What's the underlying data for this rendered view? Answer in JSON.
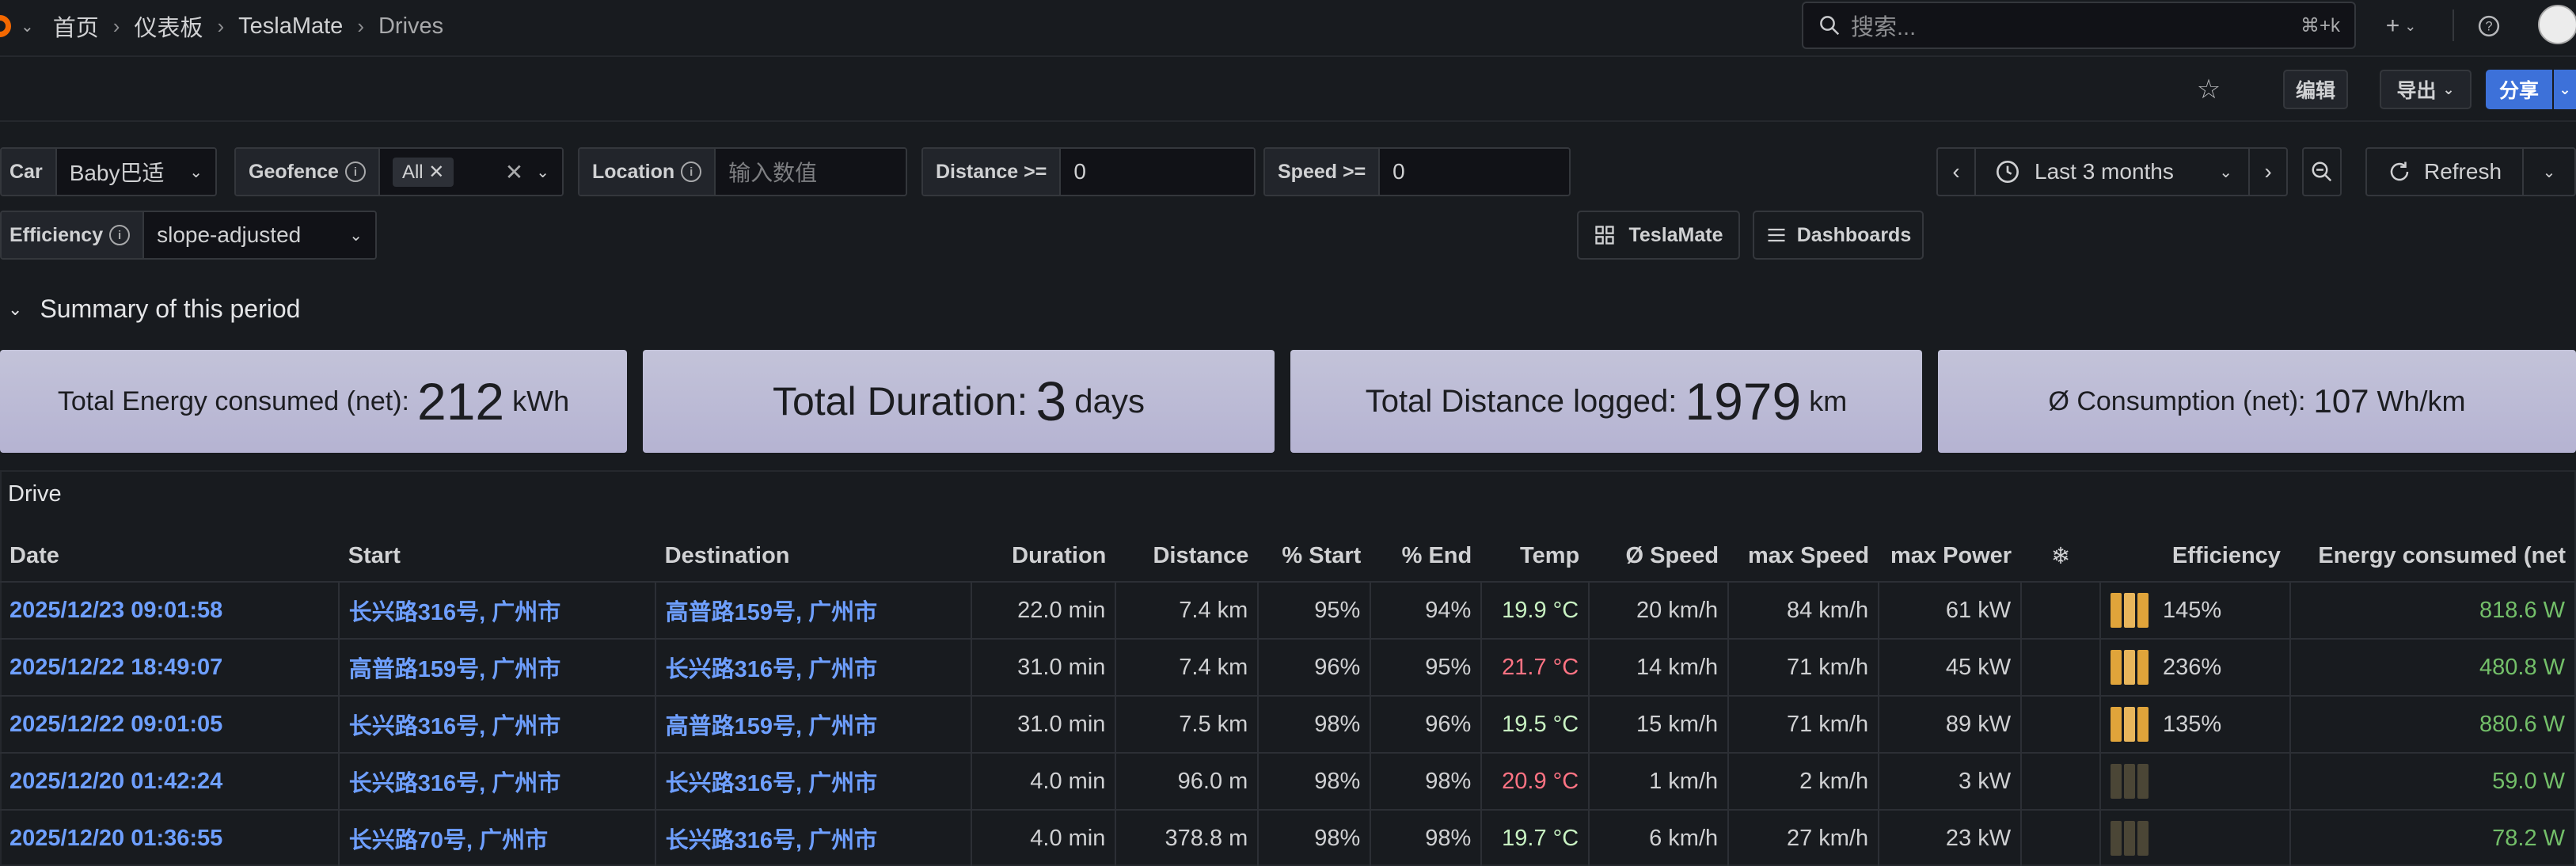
{
  "breadcrumb": [
    "首页",
    "仪表板",
    "TeslaMate",
    "Drives"
  ],
  "search": {
    "placeholder": "搜索...",
    "shortcut": "⌘+k"
  },
  "toolbar": {
    "edit": "编辑",
    "export": "导出",
    "share": "分享"
  },
  "variables": {
    "car": {
      "label": "Car",
      "value": "Baby巴适"
    },
    "geofence": {
      "label": "Geofence",
      "value": "All"
    },
    "location": {
      "label": "Location",
      "placeholder": "输入数值"
    },
    "distance": {
      "label": "Distance >=",
      "value": "0"
    },
    "speed": {
      "label": "Speed >=",
      "value": "0"
    },
    "efficiency": {
      "label": "Efficiency",
      "value": "slope-adjusted"
    }
  },
  "links": {
    "teslamate": "TeslaMate",
    "dashboards": "Dashboards"
  },
  "time_range": {
    "label": "Last 3 months",
    "refresh": "Refresh"
  },
  "summary": {
    "title": "Summary of this period",
    "stats": [
      {
        "label": "Total Energy consumed (net):",
        "value": "212",
        "unit": "kWh"
      },
      {
        "label": "Total Duration:",
        "value": "3",
        "unit": "days"
      },
      {
        "label": "Total Distance logged:",
        "value": "1979",
        "unit": "km"
      },
      {
        "label": "Ø Consumption (net):",
        "value": "107",
        "unit": "Wh/km"
      }
    ]
  },
  "drive": {
    "title": "Drive",
    "columns": [
      "Date",
      "Start",
      "Destination",
      "Duration",
      "Distance",
      "% Start",
      "% End",
      "Temp",
      "Ø Speed",
      "max Speed",
      "max Power",
      "❄",
      "Efficiency",
      "Energy consumed (net"
    ],
    "rows": [
      {
        "date": "2025/12/23 09:01:58",
        "start": "长兴路316号, 广州市",
        "dest": "高普路159号, 广州市",
        "duration": "22.0 min",
        "distance": "7.4 km",
        "pstart": "95%",
        "pend": "94%",
        "temp": "19.9 °C",
        "temp_class": "lgreen",
        "avg_speed": "20 km/h",
        "max_speed": "84 km/h",
        "max_power": "61 kW",
        "eff_level": 1,
        "efficiency": "145%",
        "energy": "818.6 W"
      },
      {
        "date": "2025/12/22 18:49:07",
        "start": "高普路159号, 广州市",
        "dest": "长兴路316号, 广州市",
        "duration": "31.0 min",
        "distance": "7.4 km",
        "pstart": "96%",
        "pend": "95%",
        "temp": "21.7 °C",
        "temp_class": "red",
        "avg_speed": "14 km/h",
        "max_speed": "71 km/h",
        "max_power": "45 kW",
        "eff_level": 1,
        "efficiency": "236%",
        "energy": "480.8 W"
      },
      {
        "date": "2025/12/22 09:01:05",
        "start": "长兴路316号, 广州市",
        "dest": "高普路159号, 广州市",
        "duration": "31.0 min",
        "distance": "7.5 km",
        "pstart": "98%",
        "pend": "96%",
        "temp": "19.5 °C",
        "temp_class": "lgreen",
        "avg_speed": "15 km/h",
        "max_speed": "71 km/h",
        "max_power": "89 kW",
        "eff_level": 1,
        "efficiency": "135%",
        "energy": "880.6 W"
      },
      {
        "date": "2025/12/20 01:42:24",
        "start": "长兴路316号, 广州市",
        "dest": "长兴路316号, 广州市",
        "duration": "4.0 min",
        "distance": "96.0 m",
        "pstart": "98%",
        "pend": "98%",
        "temp": "20.9 °C",
        "temp_class": "red",
        "avg_speed": "1 km/h",
        "max_speed": "2 km/h",
        "max_power": "3 kW",
        "eff_level": 0,
        "efficiency": "",
        "energy": "59.0 W"
      },
      {
        "date": "2025/12/20 01:36:55",
        "start": "长兴路70号, 广州市",
        "dest": "长兴路316号, 广州市",
        "duration": "4.0 min",
        "distance": "378.8 m",
        "pstart": "98%",
        "pend": "98%",
        "temp": "19.7 °C",
        "temp_class": "lgreen",
        "avg_speed": "6 km/h",
        "max_speed": "27 km/h",
        "max_power": "23 kW",
        "eff_level": 0,
        "efficiency": "",
        "energy": "78.2 W"
      }
    ]
  }
}
